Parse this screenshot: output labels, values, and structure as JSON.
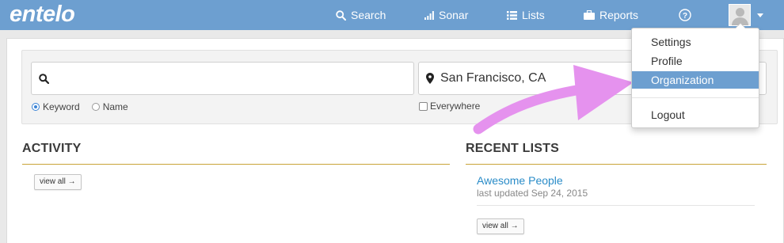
{
  "header": {
    "logo": "entelo",
    "nav": [
      {
        "label": "Search",
        "icon": "search-icon"
      },
      {
        "label": "Sonar",
        "icon": "signal-bars-icon"
      },
      {
        "label": "Lists",
        "icon": "list-icon"
      },
      {
        "label": "Reports",
        "icon": "briefcase-icon"
      }
    ],
    "help_icon": "question-circle-icon",
    "avatar_icon": "user-avatar-icon"
  },
  "search": {
    "keyword_value": "",
    "location_value": "San Francisco, CA",
    "mode_options": [
      "Keyword",
      "Name"
    ],
    "mode_selected": "Keyword",
    "everywhere_label": "Everywhere",
    "everywhere_checked": false
  },
  "activity": {
    "title": "ACTIVITY",
    "view_all_label": "view all →"
  },
  "recent_lists": {
    "title": "RECENT LISTS",
    "items": [
      {
        "name": "Awesome People",
        "meta": "last updated Sep 24, 2015"
      }
    ],
    "view_all_label": "view all →"
  },
  "user_menu": {
    "items": [
      "Settings",
      "Profile",
      "Organization",
      "Logout"
    ],
    "active": "Organization"
  },
  "colors": {
    "nav_bg": "#6d9fd0",
    "accent_rule": "#c9a338",
    "link": "#2a8cc8",
    "annotation_arrow": "#e592ee"
  }
}
